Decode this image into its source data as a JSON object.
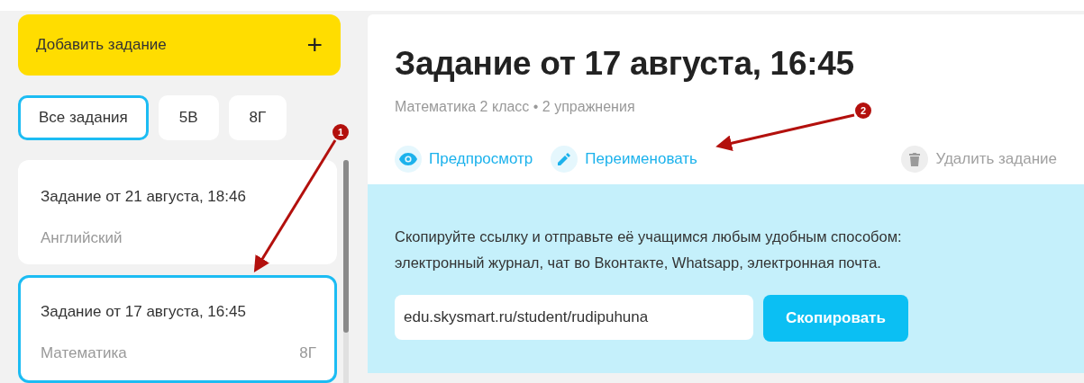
{
  "sidebar": {
    "add_button": {
      "label": "Добавить задание",
      "icon": "+"
    },
    "filters": [
      {
        "label": "Все задания",
        "selected": true
      },
      {
        "label": "5В",
        "selected": false
      },
      {
        "label": "8Г",
        "selected": false
      }
    ],
    "assignments": [
      {
        "title": "Задание от 21 августа, 18:46",
        "subject": "Английский",
        "selected": false
      },
      {
        "title": "Задание от 17 августа, 16:45",
        "subject": "Математика",
        "class": "8Г",
        "selected": true
      }
    ]
  },
  "detail": {
    "title": "Задание от 17 августа, 16:45",
    "subtitle": "Математика 2 класс • 2 упражнения",
    "actions": [
      {
        "kind": "preview",
        "label": "Предпросмотр"
      },
      {
        "kind": "rename",
        "label": "Переименовать"
      },
      {
        "kind": "delete",
        "label": "Удалить задание"
      }
    ],
    "share": {
      "text": "Скопируйте ссылку и отправьте её учащимся любым удобным способом: электронный журнал, чат во Вконтакте, Whatsapp, электронная почта.",
      "link": "edu.skysmart.ru/student/rudipuhuna",
      "button": "Скопировать"
    }
  },
  "annotations": [
    {
      "label": "1"
    },
    {
      "label": "2"
    }
  ]
}
